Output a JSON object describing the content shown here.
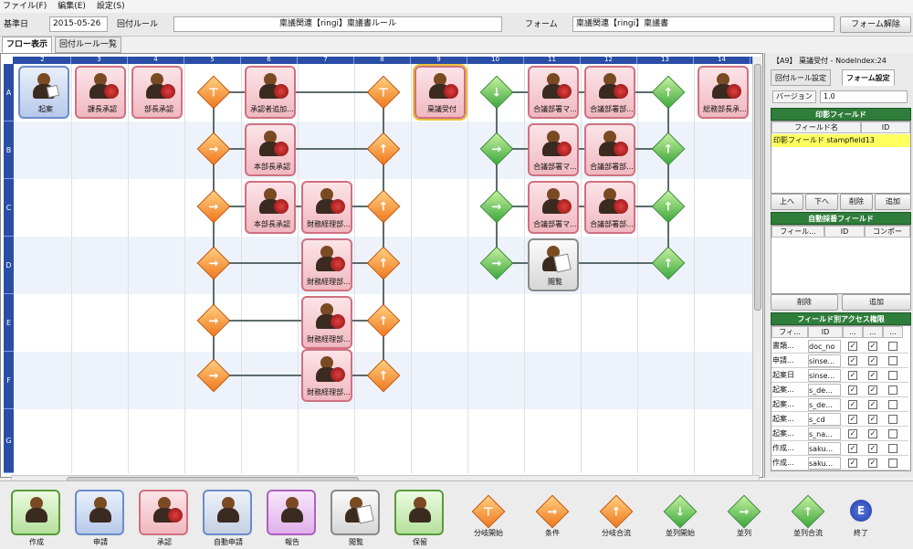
{
  "menu": [
    "ファイル(F)",
    "編集(E)",
    "設定(S)"
  ],
  "toolbar": {
    "date_label": "基準日",
    "date_value": "2015-05-26",
    "rule_label": "回付ルール",
    "rule_value": "稟議関連【ringi】稟議書ルール",
    "form_label": "フォーム",
    "form_value": "稟議関連【ringi】稟議書",
    "form_release_button": "フォーム解除"
  },
  "tabs": [
    "フロー表示",
    "回付ルール一覧"
  ],
  "grid": {
    "columns": [
      "2",
      "3",
      "4",
      "5",
      "6",
      "7",
      "8",
      "9",
      "10",
      "11",
      "12",
      "13",
      "14"
    ],
    "rows": [
      "A",
      "B",
      "C",
      "D",
      "E",
      "F",
      "G"
    ]
  },
  "nodes": {
    "kian": "起案",
    "kachou": "課長承認",
    "buchou": "部長承認",
    "shouninsha": "承認者追加...",
    "honbucho": "本部長承認",
    "honbucho2": "本部長承認",
    "zaimu1": "財務経理部...",
    "zaimu2": "財務経理部...",
    "zaimu3": "財務経理部...",
    "zaimu4": "財務経理部...",
    "ringi": "稟議受付",
    "gogi1": "合議部署マ...",
    "gogi2": "合議部署部...",
    "gogi3": "合議部署マ...",
    "gogi4": "合議部署部...",
    "gogi5": "合議部署マ...",
    "gogi6": "合議部署部...",
    "etsuran": "閲覧",
    "soumu": "総務部長承..."
  },
  "right": {
    "title": "【A9】 稟議受付 - NodeIndex:24",
    "tabs": [
      "回付ルール設定",
      "フォーム設定"
    ],
    "version_label": "バージョン",
    "version_value": "1.0",
    "stamp_section": "印影フィールド",
    "stamp_headers": [
      "フィールド名",
      "ID"
    ],
    "stamp_row": "印影フィールド stampfield13",
    "buttons_stamp": [
      "上へ",
      "下へ",
      "削除",
      "追加"
    ],
    "auto_section": "自動採番フィールド",
    "auto_headers": [
      "フィール...",
      "ID",
      "コンポー"
    ],
    "buttons_auto": [
      "削除",
      "追加"
    ],
    "access_section": "フィールド別アクセス権限",
    "access_headers": [
      "フィ...",
      "ID",
      "...",
      "...",
      "..."
    ],
    "access_rows": [
      {
        "name": "書類...",
        "id": "doc_no"
      },
      {
        "name": "申請...",
        "id": "sinse..."
      },
      {
        "name": "起案日",
        "id": "sinse..."
      },
      {
        "name": "起案...",
        "id": "s_de..."
      },
      {
        "name": "起案...",
        "id": "s_de..."
      },
      {
        "name": "起案...",
        "id": "s_cd"
      },
      {
        "name": "起案...",
        "id": "s_na..."
      },
      {
        "name": "作成...",
        "id": "saku..."
      },
      {
        "name": "作成...",
        "id": "saku..."
      }
    ]
  },
  "palette": {
    "cards": [
      "作成",
      "申請",
      "承認",
      "自動申請",
      "報告",
      "閲覧",
      "保留"
    ],
    "diamonds": [
      "分岐開始",
      "条件",
      "分岐合流",
      "並列開始",
      "並列",
      "並列合流"
    ],
    "end": "終了",
    "end_letter": "E"
  },
  "colors": {
    "header_blue": "#2a4ea6",
    "section_green": "#2f7d3a",
    "orange": "#f07820",
    "green": "#3ca83c"
  }
}
